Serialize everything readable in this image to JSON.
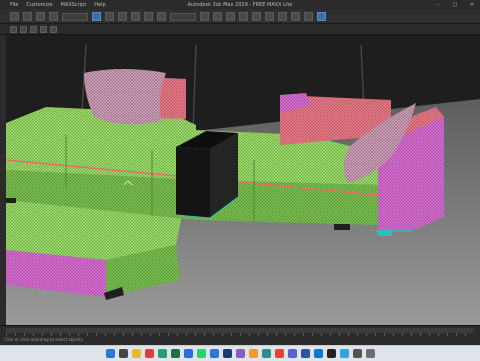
{
  "window": {
    "title": "Autodesk 3ds Max 2019 - FREE MAXX Lite",
    "menu": [
      "File",
      "Customize",
      "MAXScript",
      "Help"
    ],
    "controls": [
      "minimize",
      "maximize",
      "close"
    ]
  },
  "viewport": {
    "content": "sofa-wireframe-render",
    "colors": {
      "bg_top": "#1e1e1e",
      "floor": "#8c8c8c",
      "green_mesh": "#9fdb6a",
      "magenta_mesh": "#d46fd0",
      "coral_mesh": "#e57b86",
      "pillow": "#cc9fb8",
      "black_table": "#1a1a1a",
      "cyan_edge": "#21c6b5"
    }
  },
  "statusbar": {
    "prompt": "Click or click-and-drag to select objects"
  },
  "taskbar": {
    "icons": [
      {
        "name": "windows-start-icon",
        "color": "#2b78d6"
      },
      {
        "name": "search-icon",
        "color": "#444"
      },
      {
        "name": "file-explorer-icon",
        "color": "#e6b93a"
      },
      {
        "name": "chrome-icon",
        "color": "#d9413a"
      },
      {
        "name": "edge-icon",
        "color": "#2a9c75"
      },
      {
        "name": "excel-icon",
        "color": "#1e7145"
      },
      {
        "name": "store-icon",
        "color": "#2b6cd6"
      },
      {
        "name": "whatsapp-icon",
        "color": "#25d366"
      },
      {
        "name": "mail-icon",
        "color": "#2b78d6"
      },
      {
        "name": "photoshop-icon",
        "color": "#1a3c6e"
      },
      {
        "name": "photos-icon",
        "color": "#8a5cc2"
      },
      {
        "name": "illustrator-icon",
        "color": "#f29b2c"
      },
      {
        "name": "3dsmax-icon",
        "color": "#2a8f8a"
      },
      {
        "name": "media-icon",
        "color": "#e0463a"
      },
      {
        "name": "teams-icon",
        "color": "#5b5fc7"
      },
      {
        "name": "word-icon",
        "color": "#2b579a"
      },
      {
        "name": "vscode-icon",
        "color": "#0a7acc"
      },
      {
        "name": "notion-icon",
        "color": "#222"
      },
      {
        "name": "telegram-icon",
        "color": "#2ca5e0"
      },
      {
        "name": "camera-icon",
        "color": "#555"
      },
      {
        "name": "settings-icon",
        "color": "#6d6d6d"
      }
    ],
    "tray": {
      "time": "",
      "date": ""
    }
  }
}
